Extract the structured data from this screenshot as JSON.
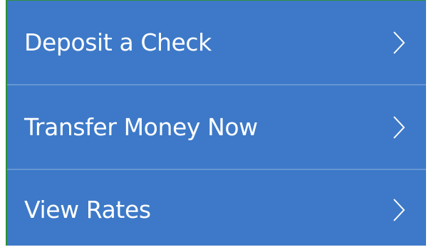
{
  "menu": {
    "items": [
      {
        "label": "Deposit a Check",
        "icon": "chevron-right-icon"
      },
      {
        "label": "Transfer Money Now",
        "icon": "chevron-right-icon"
      },
      {
        "label": "View Rates",
        "icon": "chevron-right-icon"
      }
    ]
  },
  "colors": {
    "panel_background": "#3d79c8",
    "text": "#ffffff",
    "divider": "rgba(255,255,255,0.22)"
  }
}
